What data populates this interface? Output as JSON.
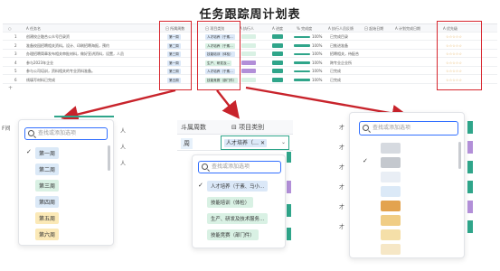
{
  "title": "任务跟踪周计划表",
  "table": {
    "headers": [
      "",
      "A 任务名",
      "",
      "",
      "",
      "",
      "日 所属周数",
      "日 项目类别",
      "A 执行人",
      "A 进度",
      "% 完成度",
      "A 执行人员反馈",
      "日 起始日期",
      "A 计划完成日期",
      "A 优先级"
    ],
    "rows": [
      {
        "num": "1",
        "name": "创建校企融合公众号目录资",
        "week": "第一周",
        "category": "人才培养（于素…",
        "progress": "100%",
        "feedback": "已完成目录",
        "priority": "☆☆☆☆☆"
      },
      {
        "num": "2",
        "name": "准备校园招聘相关资料。设计、印刷招聘海报，预约",
        "week": "第二周",
        "category": "人才培养（于素…",
        "progress": "100%",
        "feedback": "已推进准备",
        "priority": "☆☆☆☆☆"
      },
      {
        "num": "3",
        "name": "办理招聘简章发布相关审批材料，做好宣讲资料，设置，人员",
        "week": "第三周",
        "category": "技能培训（体检）",
        "progress": "100%",
        "feedback": "招聘相关，待配合",
        "priority": "☆☆☆☆☆"
      },
      {
        "num": "4",
        "name": "参与2023年企业",
        "week": "第一周",
        "category": "生产、研发及…",
        "progress": "100%",
        "feedback": "跨专业企业所",
        "priority": "☆☆☆☆☆"
      },
      {
        "num": "5",
        "name": "参与公司培训，资料相关的专业资料准备。",
        "week": "第三周",
        "category": "人才培养（于素…",
        "progress": "100%",
        "feedback": "已完成",
        "priority": "☆☆☆☆☆"
      },
      {
        "num": "6",
        "name": "线填写材料已完成",
        "week": "第五周",
        "category": "技能竞赛（部门件）",
        "progress": "100%",
        "feedback": "已完成",
        "priority": "☆☆☆☆☆"
      }
    ],
    "add_row": "+"
  },
  "panel_week": {
    "header_fragment": "F间",
    "search_placeholder": "查找或添加选项",
    "options": [
      "第一周",
      "第二周",
      "第三周",
      "第四周",
      "第五周",
      "第六周"
    ],
    "selected_index": 0,
    "side_fragments": [
      "人",
      "人",
      "人"
    ]
  },
  "panel_category": {
    "col1_header": "斗属周数",
    "col2_header": "项目类别",
    "week_cell": "周",
    "selected_tag": "人才培养（…",
    "search_placeholder": "查找或添加选项",
    "options": [
      "人才培养（于素、马小…",
      "技能培训（体检）",
      "生产、研发及技术服务…",
      "技能竞赛（部门件）"
    ],
    "selected_index": 0
  },
  "panel_priority": {
    "search_placeholder": "查找或添加选项",
    "side_fragments": [
      "才",
      "才",
      "才",
      "才",
      "才",
      "才"
    ],
    "swatch_colors": [
      "#d6dae0",
      "#c4c8ce",
      "#e9eef5",
      "#dbe9f7",
      "#e3a34f",
      "#f0cd85",
      "#f5dfa8",
      "#f6e7c6"
    ],
    "selected_index": 1
  },
  "colors": {
    "accent_red": "#d7262e",
    "tag_blue": "#dbe8f8",
    "tag_green": "#d9f1e4",
    "tag_purple": "#b28fd8",
    "progress_green": "#2fa58a",
    "teal": "#2fa58a"
  }
}
